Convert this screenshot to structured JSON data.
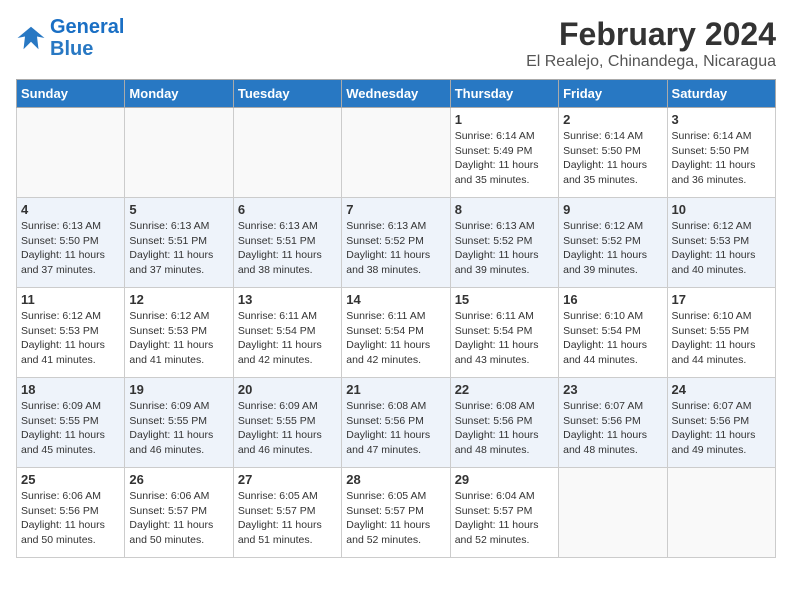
{
  "header": {
    "logo_line1": "General",
    "logo_line2": "Blue",
    "title": "February 2024",
    "subtitle": "El Realejo, Chinandega, Nicaragua"
  },
  "weekdays": [
    "Sunday",
    "Monday",
    "Tuesday",
    "Wednesday",
    "Thursday",
    "Friday",
    "Saturday"
  ],
  "weeks": [
    [
      {
        "day": "",
        "info": ""
      },
      {
        "day": "",
        "info": ""
      },
      {
        "day": "",
        "info": ""
      },
      {
        "day": "",
        "info": ""
      },
      {
        "day": "1",
        "info": "Sunrise: 6:14 AM\nSunset: 5:49 PM\nDaylight: 11 hours\nand 35 minutes."
      },
      {
        "day": "2",
        "info": "Sunrise: 6:14 AM\nSunset: 5:50 PM\nDaylight: 11 hours\nand 35 minutes."
      },
      {
        "day": "3",
        "info": "Sunrise: 6:14 AM\nSunset: 5:50 PM\nDaylight: 11 hours\nand 36 minutes."
      }
    ],
    [
      {
        "day": "4",
        "info": "Sunrise: 6:13 AM\nSunset: 5:50 PM\nDaylight: 11 hours\nand 37 minutes."
      },
      {
        "day": "5",
        "info": "Sunrise: 6:13 AM\nSunset: 5:51 PM\nDaylight: 11 hours\nand 37 minutes."
      },
      {
        "day": "6",
        "info": "Sunrise: 6:13 AM\nSunset: 5:51 PM\nDaylight: 11 hours\nand 38 minutes."
      },
      {
        "day": "7",
        "info": "Sunrise: 6:13 AM\nSunset: 5:52 PM\nDaylight: 11 hours\nand 38 minutes."
      },
      {
        "day": "8",
        "info": "Sunrise: 6:13 AM\nSunset: 5:52 PM\nDaylight: 11 hours\nand 39 minutes."
      },
      {
        "day": "9",
        "info": "Sunrise: 6:12 AM\nSunset: 5:52 PM\nDaylight: 11 hours\nand 39 minutes."
      },
      {
        "day": "10",
        "info": "Sunrise: 6:12 AM\nSunset: 5:53 PM\nDaylight: 11 hours\nand 40 minutes."
      }
    ],
    [
      {
        "day": "11",
        "info": "Sunrise: 6:12 AM\nSunset: 5:53 PM\nDaylight: 11 hours\nand 41 minutes."
      },
      {
        "day": "12",
        "info": "Sunrise: 6:12 AM\nSunset: 5:53 PM\nDaylight: 11 hours\nand 41 minutes."
      },
      {
        "day": "13",
        "info": "Sunrise: 6:11 AM\nSunset: 5:54 PM\nDaylight: 11 hours\nand 42 minutes."
      },
      {
        "day": "14",
        "info": "Sunrise: 6:11 AM\nSunset: 5:54 PM\nDaylight: 11 hours\nand 42 minutes."
      },
      {
        "day": "15",
        "info": "Sunrise: 6:11 AM\nSunset: 5:54 PM\nDaylight: 11 hours\nand 43 minutes."
      },
      {
        "day": "16",
        "info": "Sunrise: 6:10 AM\nSunset: 5:54 PM\nDaylight: 11 hours\nand 44 minutes."
      },
      {
        "day": "17",
        "info": "Sunrise: 6:10 AM\nSunset: 5:55 PM\nDaylight: 11 hours\nand 44 minutes."
      }
    ],
    [
      {
        "day": "18",
        "info": "Sunrise: 6:09 AM\nSunset: 5:55 PM\nDaylight: 11 hours\nand 45 minutes."
      },
      {
        "day": "19",
        "info": "Sunrise: 6:09 AM\nSunset: 5:55 PM\nDaylight: 11 hours\nand 46 minutes."
      },
      {
        "day": "20",
        "info": "Sunrise: 6:09 AM\nSunset: 5:55 PM\nDaylight: 11 hours\nand 46 minutes."
      },
      {
        "day": "21",
        "info": "Sunrise: 6:08 AM\nSunset: 5:56 PM\nDaylight: 11 hours\nand 47 minutes."
      },
      {
        "day": "22",
        "info": "Sunrise: 6:08 AM\nSunset: 5:56 PM\nDaylight: 11 hours\nand 48 minutes."
      },
      {
        "day": "23",
        "info": "Sunrise: 6:07 AM\nSunset: 5:56 PM\nDaylight: 11 hours\nand 48 minutes."
      },
      {
        "day": "24",
        "info": "Sunrise: 6:07 AM\nSunset: 5:56 PM\nDaylight: 11 hours\nand 49 minutes."
      }
    ],
    [
      {
        "day": "25",
        "info": "Sunrise: 6:06 AM\nSunset: 5:56 PM\nDaylight: 11 hours\nand 50 minutes."
      },
      {
        "day": "26",
        "info": "Sunrise: 6:06 AM\nSunset: 5:57 PM\nDaylight: 11 hours\nand 50 minutes."
      },
      {
        "day": "27",
        "info": "Sunrise: 6:05 AM\nSunset: 5:57 PM\nDaylight: 11 hours\nand 51 minutes."
      },
      {
        "day": "28",
        "info": "Sunrise: 6:05 AM\nSunset: 5:57 PM\nDaylight: 11 hours\nand 52 minutes."
      },
      {
        "day": "29",
        "info": "Sunrise: 6:04 AM\nSunset: 5:57 PM\nDaylight: 11 hours\nand 52 minutes."
      },
      {
        "day": "",
        "info": ""
      },
      {
        "day": "",
        "info": ""
      }
    ]
  ]
}
